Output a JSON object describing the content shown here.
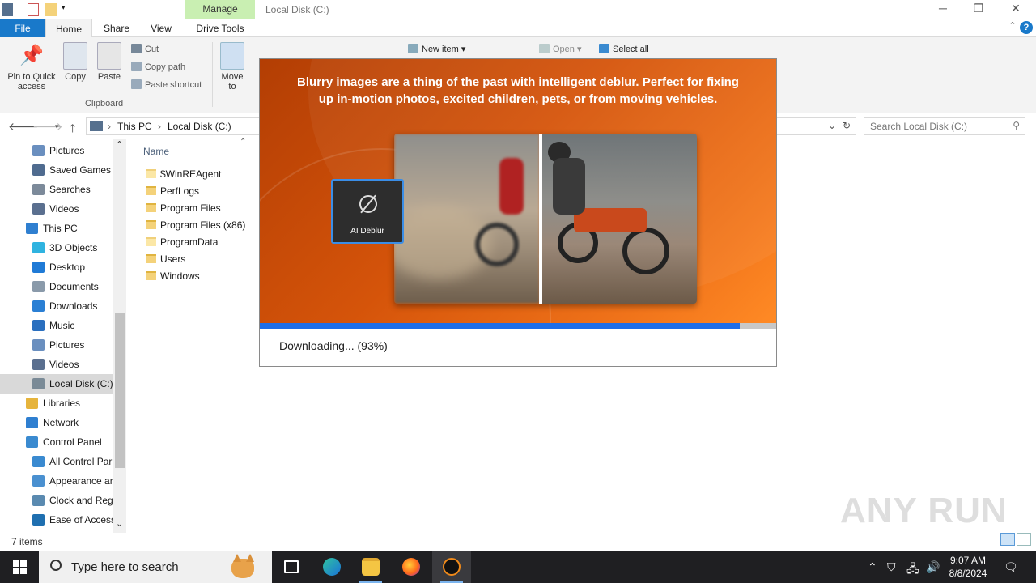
{
  "window": {
    "title": "Local Disk (C:)",
    "manage_tab": "Manage"
  },
  "tabs": [
    {
      "label": "File"
    },
    {
      "label": "Home"
    },
    {
      "label": "Share"
    },
    {
      "label": "View"
    },
    {
      "label": "Drive Tools"
    }
  ],
  "ribbon": {
    "pin_label": "Pin to Quick access",
    "copy_label": "Copy",
    "paste_label": "Paste",
    "cut_label": "Cut",
    "copy_path_label": "Copy path",
    "paste_shortcut_label": "Paste shortcut",
    "clipboard_group": "Clipboard",
    "move_to_label": "Move to",
    "new_item_label": "New item",
    "open_label": "Open",
    "select_all_label": "Select all"
  },
  "address": {
    "crumbs": [
      "This PC",
      "Local Disk (C:)"
    ],
    "search_placeholder": "Search Local Disk (C:)"
  },
  "nav": [
    {
      "label": "Pictures",
      "indent": 2,
      "color": "#6a8fbf"
    },
    {
      "label": "Saved Games",
      "indent": 2,
      "color": "#4f6b8f"
    },
    {
      "label": "Searches",
      "indent": 2,
      "color": "#7c8a9a"
    },
    {
      "label": "Videos",
      "indent": 2,
      "color": "#5a6f8f"
    },
    {
      "label": "This PC",
      "indent": 1,
      "color": "#2f7fd0"
    },
    {
      "label": "3D Objects",
      "indent": 2,
      "color": "#2fb3e0"
    },
    {
      "label": "Desktop",
      "indent": 2,
      "color": "#1f7ad6"
    },
    {
      "label": "Documents",
      "indent": 2,
      "color": "#8a9aaa"
    },
    {
      "label": "Downloads",
      "indent": 2,
      "color": "#2a7fd4"
    },
    {
      "label": "Music",
      "indent": 2,
      "color": "#2a6fbf"
    },
    {
      "label": "Pictures",
      "indent": 2,
      "color": "#6a8fbf"
    },
    {
      "label": "Videos",
      "indent": 2,
      "color": "#5a6f8f"
    },
    {
      "label": "Local Disk (C:)",
      "indent": 2,
      "color": "#7a8a96",
      "selected": true
    },
    {
      "label": "Libraries",
      "indent": 1,
      "color": "#e6b43c"
    },
    {
      "label": "Network",
      "indent": 1,
      "color": "#2f7fd0"
    },
    {
      "label": "Control Panel",
      "indent": 1,
      "color": "#3a8ad0"
    },
    {
      "label": "All Control Par",
      "indent": 2,
      "color": "#3a8ad0"
    },
    {
      "label": "Appearance an",
      "indent": 2,
      "color": "#4a90d0"
    },
    {
      "label": "Clock and Regi",
      "indent": 2,
      "color": "#5a8ab0"
    },
    {
      "label": "Ease of Access",
      "indent": 2,
      "color": "#1f6fb0"
    }
  ],
  "files": {
    "header": "Name",
    "items": [
      {
        "name": "$WinREAgent",
        "system": true
      },
      {
        "name": "PerfLogs",
        "system": false
      },
      {
        "name": "Program Files",
        "system": false
      },
      {
        "name": "Program Files (x86)",
        "system": false
      },
      {
        "name": "ProgramData",
        "system": true
      },
      {
        "name": "Users",
        "system": false
      },
      {
        "name": "Windows",
        "system": false
      }
    ]
  },
  "status": {
    "items_count": "7 items"
  },
  "popup": {
    "headline": "Blurry images are a thing of the past with intelligent deblur. Perfect for fixing up in-motion photos, excited children, pets, or from moving vehicles.",
    "feature_label": "AI Deblur",
    "download_text": "Downloading... (93%)",
    "progress": 0.93,
    "progress_color": "#1e6ee8"
  },
  "watermark": "ANY RUN",
  "taskbar": {
    "search_placeholder": "Type here to search",
    "time": "9:07 AM",
    "date": "8/8/2024"
  }
}
